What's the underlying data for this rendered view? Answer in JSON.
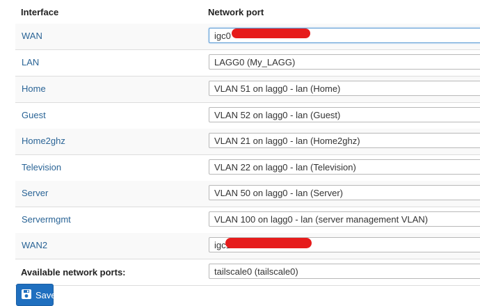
{
  "header": {
    "interface": "Interface",
    "network_port": "Network port"
  },
  "rows": [
    {
      "interface": "WAN",
      "port": "igc0"
    },
    {
      "interface": "LAN",
      "port": "LAGG0 (My_LAGG)"
    },
    {
      "interface": "Home",
      "port": "VLAN 51 on lagg0 - lan (Home)"
    },
    {
      "interface": "Guest",
      "port": "VLAN 52 on lagg0 - lan (Guest)"
    },
    {
      "interface": "Home2ghz",
      "port": "VLAN 21 on lagg0 - lan (Home2ghz)"
    },
    {
      "interface": "Television",
      "port": "VLAN 22 on lagg0 - lan (Television)"
    },
    {
      "interface": "Server",
      "port": "VLAN 50 on lagg0 - lan (Server)"
    },
    {
      "interface": "Servermgmt",
      "port": "VLAN 100 on lagg0 - lan (server management VLAN)"
    },
    {
      "interface": "WAN2",
      "port": "igc1"
    }
  ],
  "available": {
    "label": "Available network ports:",
    "value": "tailscale0 (tailscale0)"
  },
  "save_button": {
    "label": "Save",
    "icon": "save-icon"
  },
  "colors": {
    "link": "#2a6496",
    "button": "#1f6fbf",
    "redaction": "#e61c1c"
  }
}
